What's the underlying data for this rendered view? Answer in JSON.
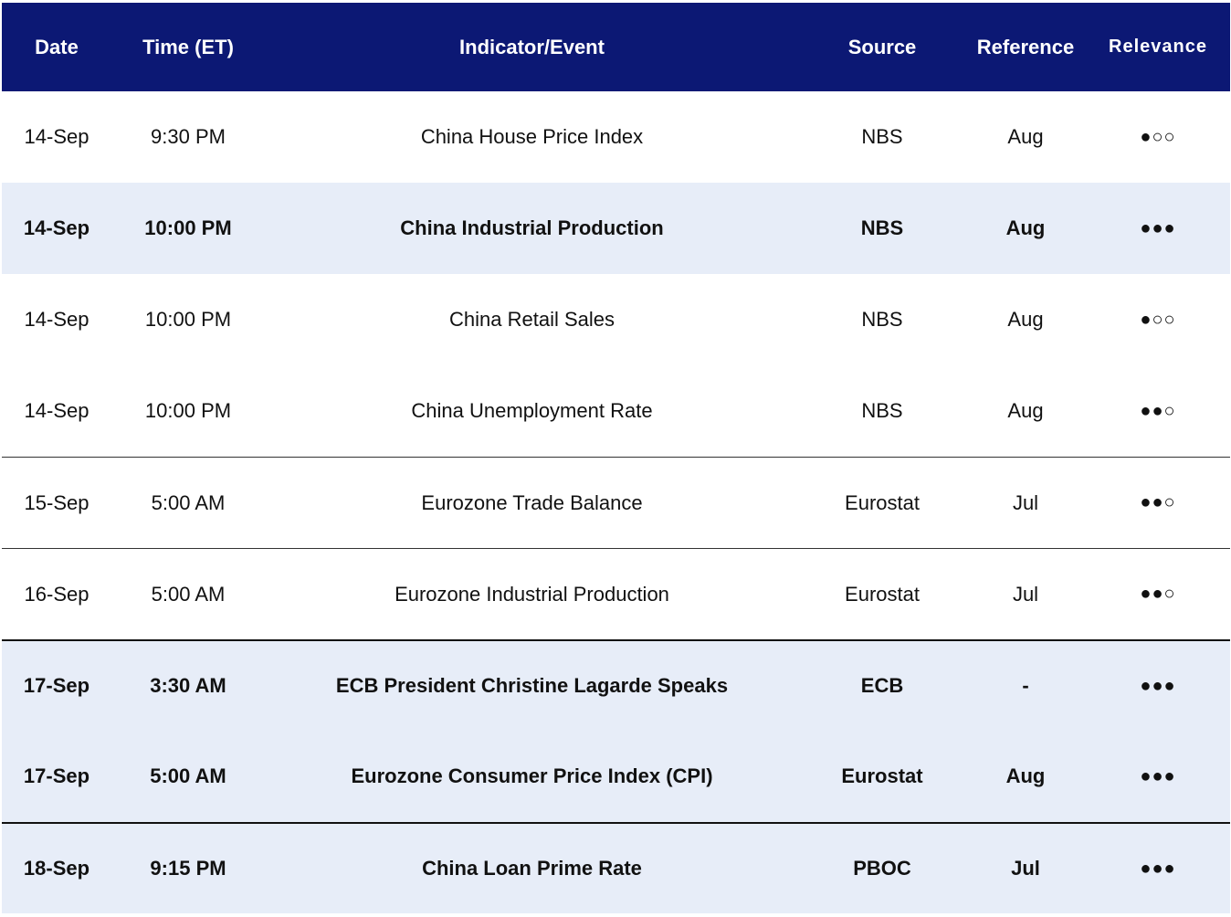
{
  "columns": {
    "date": "Date",
    "time": "Time (ET)",
    "event": "Indicator/Event",
    "source": "Source",
    "reference": "Reference",
    "relevance": "Relevance"
  },
  "rows": [
    {
      "date": "14-Sep",
      "time": "9:30 PM",
      "event": "China House Price Index",
      "source": "NBS",
      "reference": "Aug",
      "relevance": "●○○",
      "highlighted": false,
      "bold": false
    },
    {
      "date": "14-Sep",
      "time": "10:00 PM",
      "event": "China Industrial Production",
      "source": "NBS",
      "reference": "Aug",
      "relevance": "●●●",
      "highlighted": true,
      "bold": true
    },
    {
      "date": "14-Sep",
      "time": "10:00 PM",
      "event": "China Retail Sales",
      "source": "NBS",
      "reference": "Aug",
      "relevance": "●○○",
      "highlighted": false,
      "bold": false
    },
    {
      "date": "14-Sep",
      "time": "10:00 PM",
      "event": "China Unemployment Rate",
      "source": "NBS",
      "reference": "Aug",
      "relevance": "●●○",
      "highlighted": false,
      "bold": false
    },
    {
      "date": "15-Sep",
      "time": "5:00 AM",
      "event": "Eurozone Trade Balance",
      "source": "Eurostat",
      "reference": "Jul",
      "relevance": "●●○",
      "highlighted": false,
      "bold": false
    },
    {
      "date": "16-Sep",
      "time": "5:00 AM",
      "event": "Eurozone Industrial Production",
      "source": "Eurostat",
      "reference": "Jul",
      "relevance": "●●○",
      "highlighted": false,
      "bold": false
    },
    {
      "date": "17-Sep",
      "time": "3:30 AM",
      "event": "ECB President Christine Lagarde Speaks",
      "source": "ECB",
      "reference": "-",
      "relevance": "●●●",
      "highlighted": true,
      "bold": true
    },
    {
      "date": "17-Sep",
      "time": "5:00 AM",
      "event": "Eurozone Consumer Price Index (CPI)",
      "source": "Eurostat",
      "reference": "Aug",
      "relevance": "●●●",
      "highlighted": true,
      "bold": true
    },
    {
      "date": "18-Sep",
      "time": "9:15 PM",
      "event": "China Loan Prime Rate",
      "source": "PBOC",
      "reference": "Jul",
      "relevance": "●●●",
      "highlighted": true,
      "bold": true
    }
  ],
  "colors": {
    "header_bg": "#0c1874",
    "highlight_bg": "#e7edf8"
  }
}
